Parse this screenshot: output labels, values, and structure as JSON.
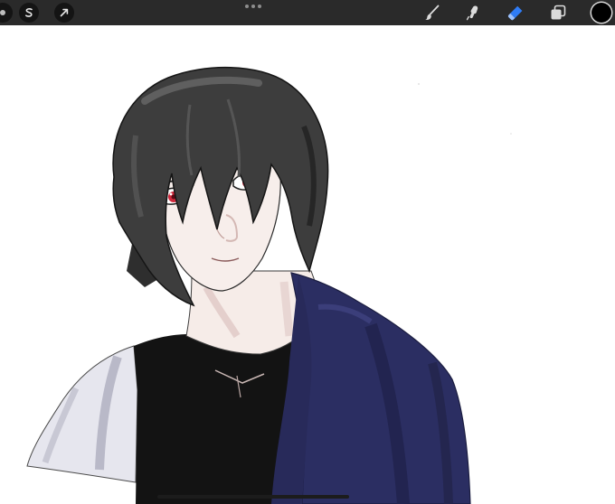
{
  "toolbar": {
    "left_tools": [
      {
        "name": "partial-menu-icon",
        "interactable": true
      },
      {
        "name": "selection-s-icon",
        "interactable": true
      },
      {
        "name": "transform-arrow-icon",
        "interactable": true
      }
    ],
    "right_tools": [
      {
        "name": "brush-icon",
        "active": false
      },
      {
        "name": "smudge-icon",
        "active": false
      },
      {
        "name": "eraser-icon",
        "active": true
      },
      {
        "name": "layers-icon",
        "active": false
      }
    ],
    "current_color": "#000000",
    "accent_color": "#2f7cf6"
  },
  "canvas": {
    "background": "#ffffff",
    "illustration": "anime-character-portrait"
  },
  "colors": {
    "toolbar_bg": "#2a2a2a",
    "hair": "#3c3c3c",
    "skin": "#f6ece8",
    "eyes": "#d0283c",
    "shirt": "#121212",
    "jacket": "#2b2e62",
    "sleeve": "#e2e2ea"
  }
}
